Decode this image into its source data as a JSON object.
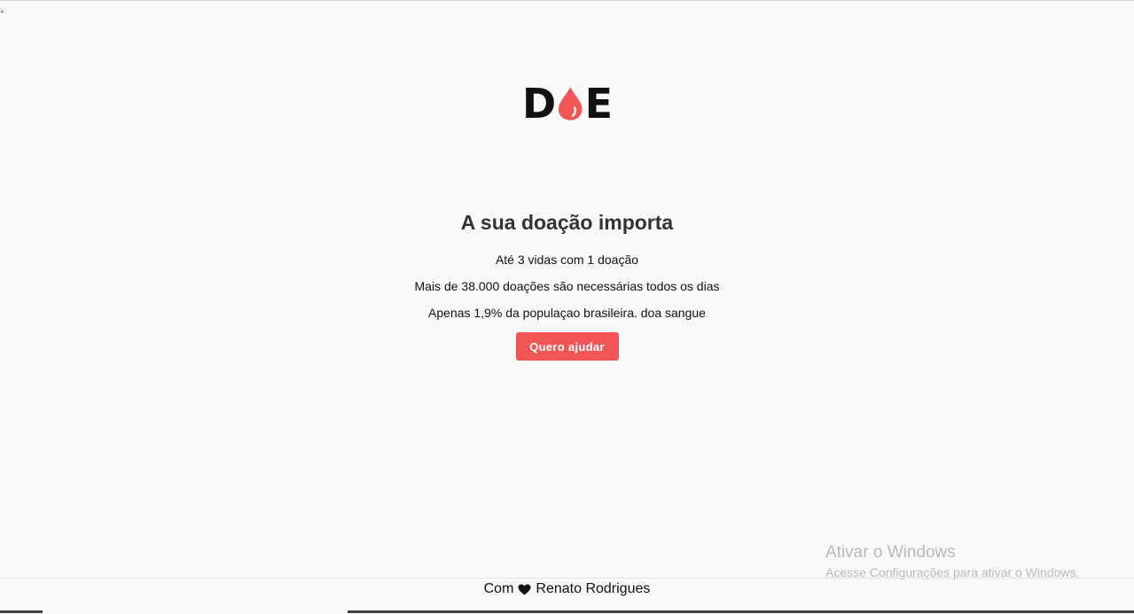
{
  "corner_link": {
    "label": "."
  },
  "logo": {
    "letter_left": "D",
    "drop_icon": "blood-drop-icon",
    "letter_right": "E",
    "drop_color": "#f25555"
  },
  "hero": {
    "title": "A sua doação importa",
    "lines": [
      "Até 3 vidas com 1 doação",
      "Mais de 38.000 doações são necessárias todos os dias",
      "Apenas 1,9% da populaçao brasileira. doa sangue"
    ],
    "cta_label": "Quero ajudar",
    "accent_color": "#f25555"
  },
  "windows_watermark": {
    "title": "Ativar o Windows",
    "subtitle": "Acesse Configurações para ativar o Windows."
  },
  "footer": {
    "prefix": "Com",
    "heart_icon": "heart-icon",
    "author": "Renato Rodrigues"
  }
}
